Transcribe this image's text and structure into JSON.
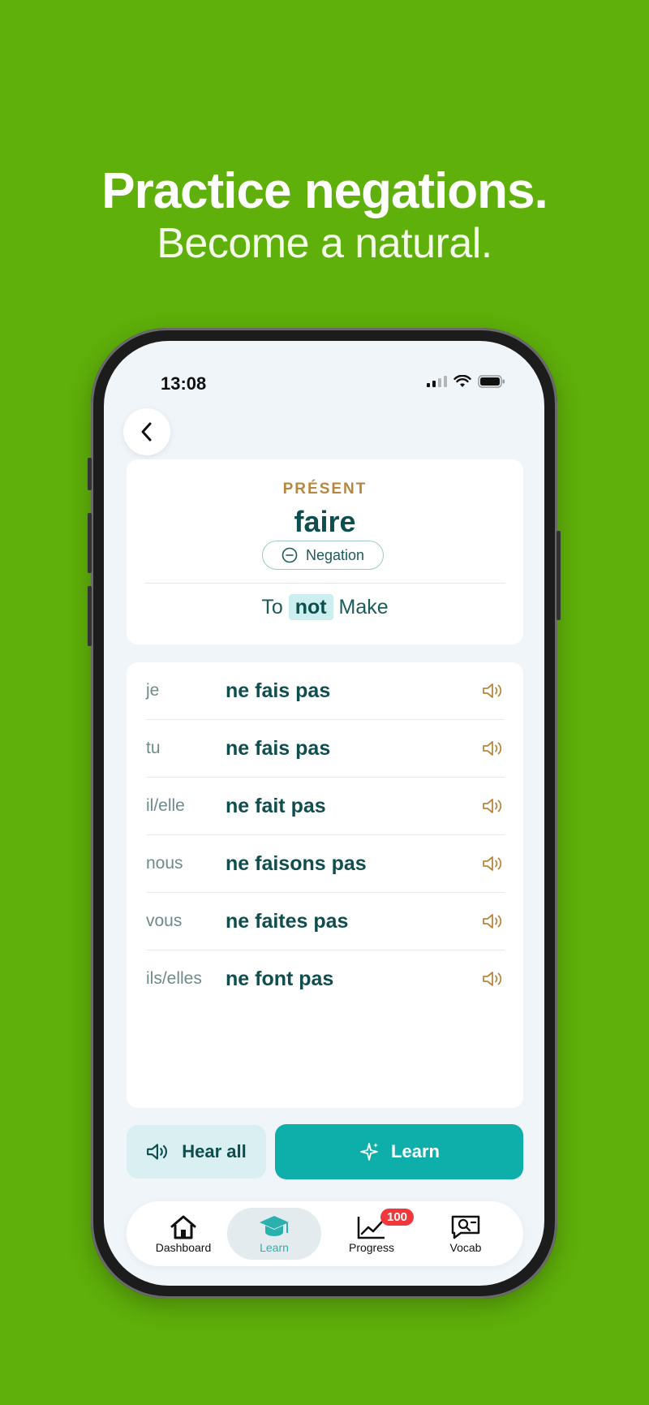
{
  "promo": {
    "headline": "Practice negations.",
    "subline": "Become a natural."
  },
  "status_bar": {
    "time": "13:08",
    "icons": [
      "signal-icon",
      "wifi-icon",
      "battery-icon"
    ]
  },
  "header": {
    "back_icon": "chevron-left-icon"
  },
  "conjugation_card": {
    "tense": "PRÉSENT",
    "verb": "faire",
    "mode_chip": "Negation",
    "meaning_pre": "To",
    "meaning_highlight": "not",
    "meaning_post": "Make"
  },
  "conjugations": [
    {
      "pronoun": "je",
      "form": "ne fais pas"
    },
    {
      "pronoun": "tu",
      "form": "ne fais pas"
    },
    {
      "pronoun": "il/elle",
      "form": "ne fait pas"
    },
    {
      "pronoun": "nous",
      "form": "ne faisons pas"
    },
    {
      "pronoun": "vous",
      "form": "ne faites pas"
    },
    {
      "pronoun": "ils/elles",
      "form": "ne font pas"
    }
  ],
  "actions": {
    "hear_all": "Hear all",
    "learn": "Learn"
  },
  "tabbar": {
    "items": [
      {
        "label": "Dashboard",
        "icon": "home-icon"
      },
      {
        "label": "Learn",
        "icon": "graduation-cap-icon",
        "active": true
      },
      {
        "label": "Progress",
        "icon": "chart-line-icon",
        "badge": "100"
      },
      {
        "label": "Vocab",
        "icon": "chat-search-icon"
      }
    ]
  },
  "colors": {
    "background": "#5fb00a",
    "accent": "#0eaeaa",
    "text_primary": "#0e4e4e",
    "tense_gold": "#b8873f",
    "badge_red": "#f0383b"
  }
}
